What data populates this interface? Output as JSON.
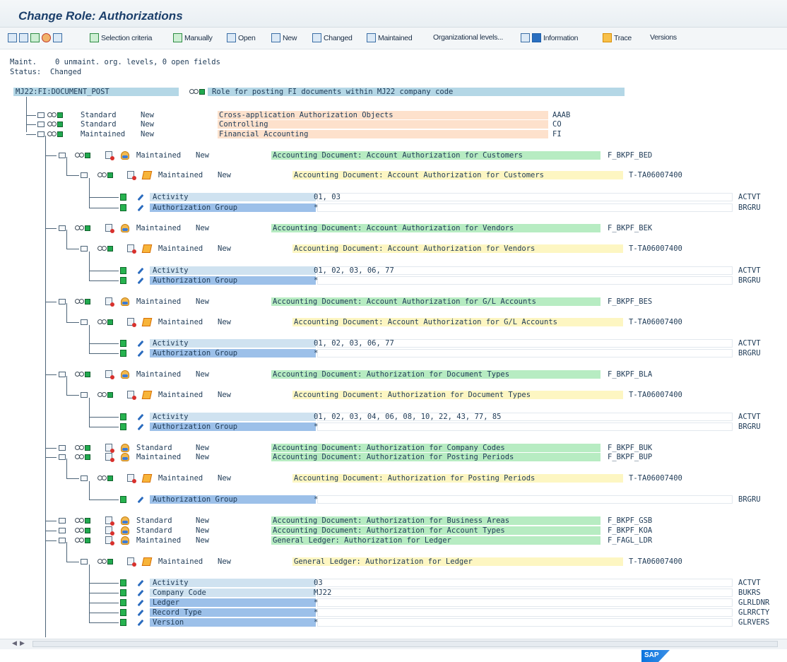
{
  "window": {
    "title": "Change Role: Authorizations"
  },
  "toolbar": {
    "selection_criteria": "Selection criteria",
    "manually": "Manually",
    "open": "Open",
    "new": "New",
    "changed": "Changed",
    "maintained": "Maintained",
    "org_levels": "Organizational levels...",
    "information": "Information",
    "trace": "Trace",
    "versions": "Versions"
  },
  "status": {
    "maint_label": "Maint.",
    "maint_value": "0 unmaint. org. levels, 0 open fields",
    "status_label": "Status:",
    "status_value": "Changed"
  },
  "root": {
    "name": "MJ22:FI:DOCUMENT_POST",
    "description": "Role for posting FI documents within MJ22 company code"
  },
  "tree_rows": [
    {
      "state": "Standard",
      "flag": "New",
      "text": "Cross-application Authorization Objects",
      "code": "AAAB"
    },
    {
      "state": "Standard",
      "flag": "New",
      "text": "Controlling",
      "code": "CO"
    },
    {
      "state": "Maintained",
      "flag": "New",
      "text": "Financial Accounting",
      "code": "FI"
    },
    {
      "state": "Maintained",
      "flag": "New",
      "text": "Accounting Document: Account Authorization for Customers",
      "code": "F_BKPF_BED"
    },
    {
      "state": "Maintained",
      "flag": "New",
      "text": "Accounting Document: Account Authorization for Customers",
      "code": "T-TA06007400"
    },
    {
      "state": "Maintained",
      "flag": "New",
      "text": "Accounting Document: Account Authorization for Vendors",
      "code": "F_BKPF_BEK"
    },
    {
      "state": "Maintained",
      "flag": "New",
      "text": "Accounting Document: Account Authorization for Vendors",
      "code": "T-TA06007400"
    },
    {
      "state": "Maintained",
      "flag": "New",
      "text": "Accounting Document: Account Authorization for G/L Accounts",
      "code": "F_BKPF_BES"
    },
    {
      "state": "Maintained",
      "flag": "New",
      "text": "Accounting Document: Account Authorization for G/L Accounts",
      "code": "T-TA06007400"
    },
    {
      "state": "Maintained",
      "flag": "New",
      "text": "Accounting Document: Authorization for Document Types",
      "code": "F_BKPF_BLA"
    },
    {
      "state": "Maintained",
      "flag": "New",
      "text": "Accounting Document: Authorization for Document Types",
      "code": "T-TA06007400"
    },
    {
      "state": "Standard",
      "flag": "New",
      "text": "Accounting Document: Authorization for Company Codes",
      "code": "F_BKPF_BUK"
    },
    {
      "state": "Maintained",
      "flag": "New",
      "text": "Accounting Document: Authorization for Posting Periods",
      "code": "F_BKPF_BUP"
    },
    {
      "state": "Maintained",
      "flag": "New",
      "text": "Accounting Document: Authorization for Posting Periods",
      "code": "T-TA06007400"
    },
    {
      "state": "Standard",
      "flag": "New",
      "text": "Accounting Document: Authorization for Business Areas",
      "code": "F_BKPF_GSB"
    },
    {
      "state": "Standard",
      "flag": "New",
      "text": "Accounting Document: Authorization for Account Types",
      "code": "F_BKPF_KOA"
    },
    {
      "state": "Maintained",
      "flag": "New",
      "text": "General Ledger: Authorization for Ledger",
      "code": "F_FAGL_LDR"
    },
    {
      "state": "Maintained",
      "flag": "New",
      "text": "General Ledger: Authorization for Ledger",
      "code": "T-TA06007400"
    }
  ],
  "fields": [
    {
      "label": "Activity",
      "value": "01, 03",
      "code": "ACTVT"
    },
    {
      "label": "Authorization Group",
      "value": "*",
      "code": "BRGRU"
    },
    {
      "label": "Activity",
      "value": "01, 02, 03, 06, 77",
      "code": "ACTVT"
    },
    {
      "label": "Authorization Group",
      "value": "*",
      "code": "BRGRU"
    },
    {
      "label": "Activity",
      "value": "01, 02, 03, 06, 77",
      "code": "ACTVT"
    },
    {
      "label": "Authorization Group",
      "value": "*",
      "code": "BRGRU"
    },
    {
      "label": "Activity",
      "value": "01, 02, 03, 04, 06, 08, 10, 22, 43, 77, 85",
      "code": "ACTVT"
    },
    {
      "label": "Authorization Group",
      "value": "*",
      "code": "BRGRU"
    },
    {
      "label": "Authorization Group",
      "value": "*",
      "code": "BRGRU"
    },
    {
      "label": "Activity",
      "value": "03",
      "code": "ACTVT"
    },
    {
      "label": "Company Code",
      "value": "MJ22",
      "code": "BUKRS"
    },
    {
      "label": "Ledger",
      "value": "*",
      "code": "GLRLDNR"
    },
    {
      "label": "Record Type",
      "value": "*",
      "code": "GLRRCTY"
    },
    {
      "label": "Version",
      "value": "*",
      "code": "GLRVERS"
    }
  ],
  "footer": {
    "logo": "SAP"
  }
}
